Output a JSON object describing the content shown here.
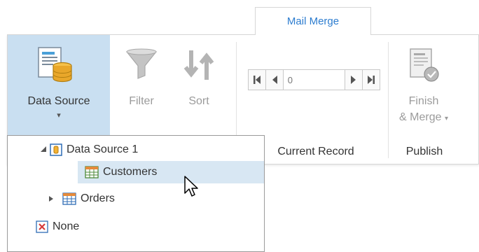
{
  "tab": {
    "label": "Mail Merge"
  },
  "ribbon": {
    "data_source": {
      "label": "Data Source",
      "arrow": "▾"
    },
    "filter": {
      "label": "Filter"
    },
    "sort": {
      "label": "Sort"
    },
    "current_record": {
      "value": "0",
      "group_label": "Current Record"
    },
    "finish_merge": {
      "label_line1": "Finish",
      "label_line2": "& Merge",
      "arrow": "▾"
    },
    "publish_group_label": "Publish"
  },
  "dropdown": {
    "items": [
      {
        "label": "Data Source 1",
        "icon": "database-icon",
        "expander": "expanded"
      },
      {
        "label": "Customers",
        "icon": "table-icon",
        "selected": true
      },
      {
        "label": "Orders",
        "icon": "table-icon",
        "expander": "collapsed"
      },
      {
        "label": "None",
        "icon": "none-x-icon"
      }
    ]
  },
  "colors": {
    "accent": "#2c7ccf",
    "selected_bg": "#d8e7f3",
    "button_hover_bg": "#c9dff1",
    "disabled_text": "#9b9b9b"
  }
}
